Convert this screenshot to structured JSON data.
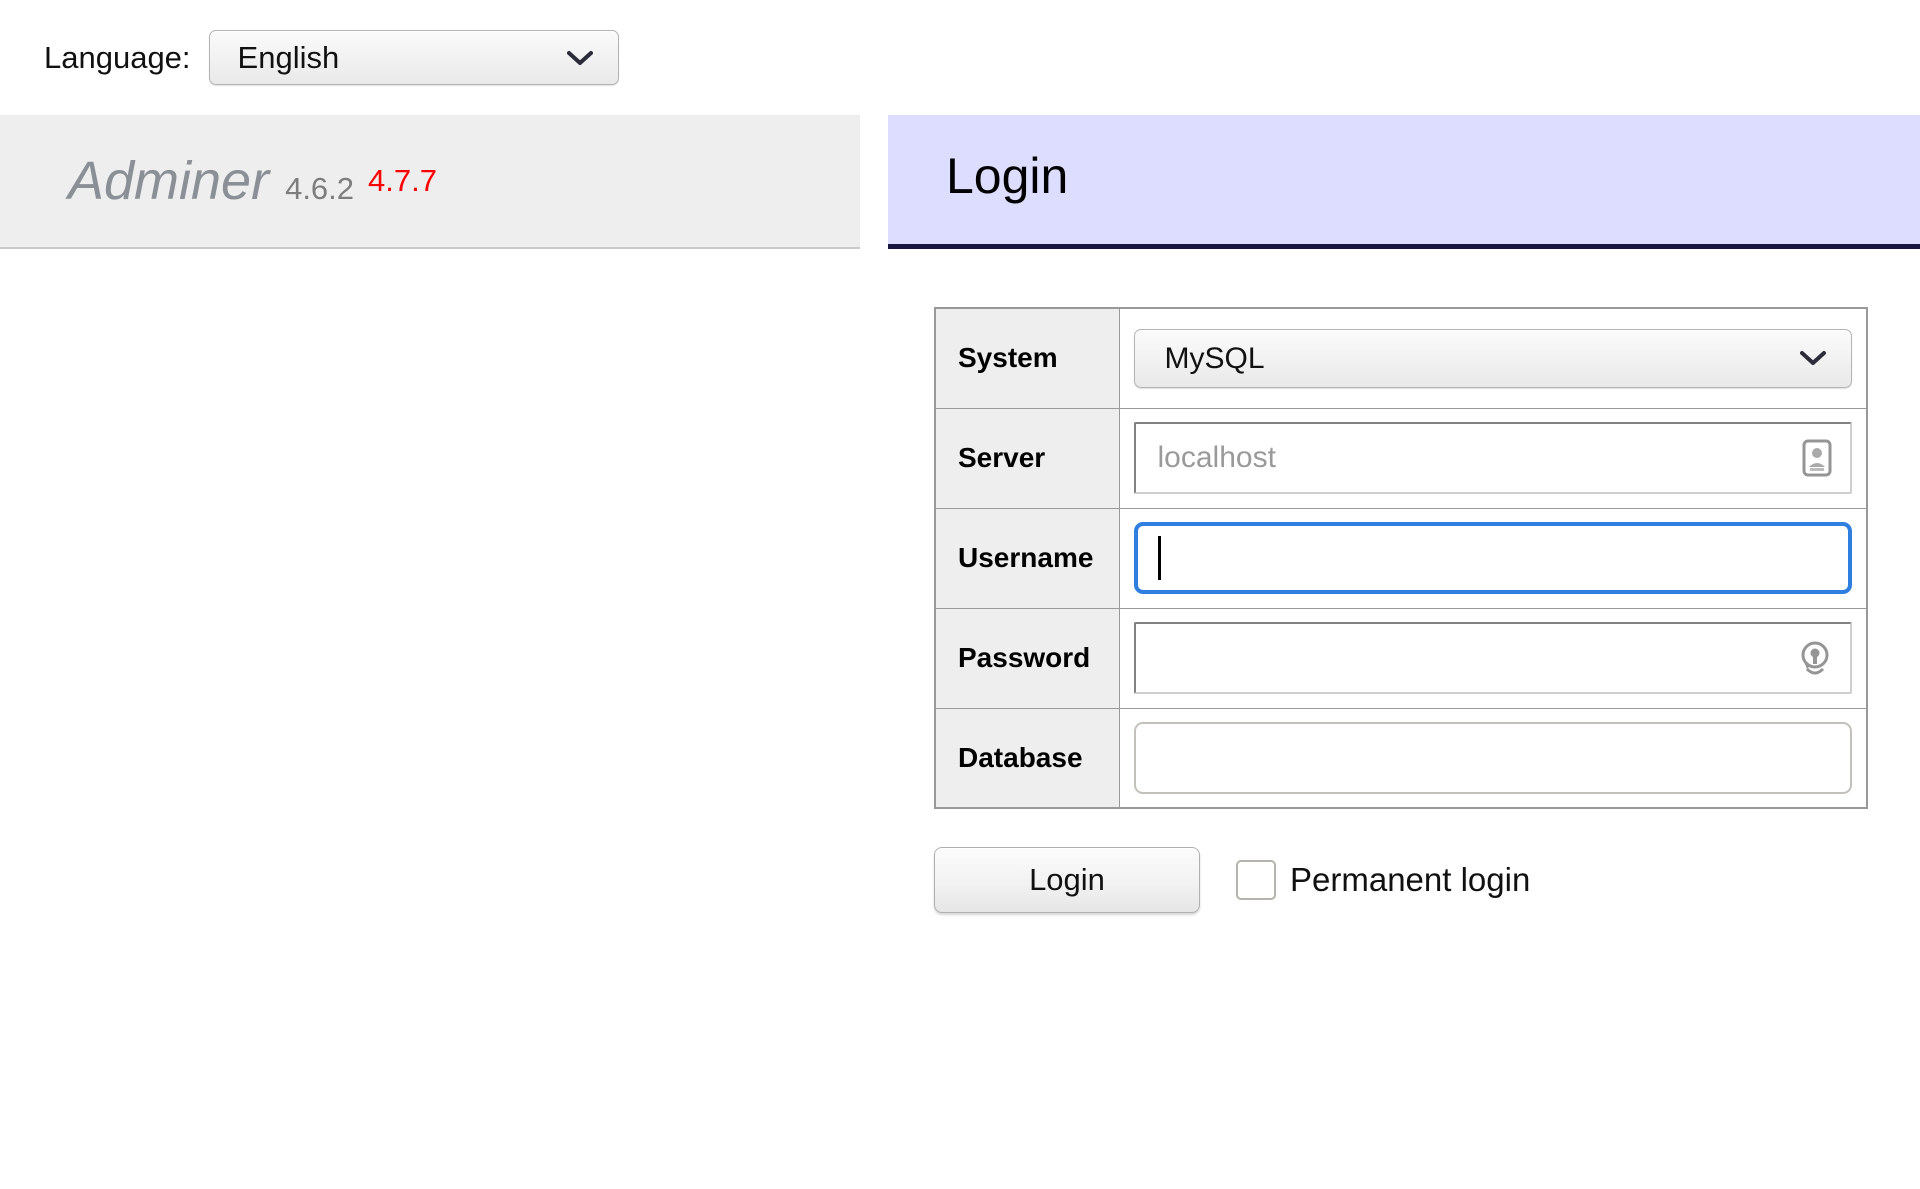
{
  "language_bar": {
    "label": "Language:",
    "selected": "English",
    "options": [
      "English"
    ],
    "chevron_icon": "chevron-down-icon"
  },
  "sidebar": {
    "logo_name": "Adminer",
    "version": "4.6.2",
    "update_version": "4.7.7",
    "update_color": "#ff0000"
  },
  "main": {
    "title": "Login",
    "title_background": "#ddddff",
    "title_underline": "#16163f"
  },
  "form": {
    "rows": [
      {
        "label": "System",
        "type": "select",
        "value": "MySQL",
        "options": [
          "MySQL"
        ],
        "icon": "chevron-down-icon"
      },
      {
        "label": "Server",
        "type": "text",
        "value": "",
        "placeholder": "localhost",
        "icon": "contact-card-autofill-icon"
      },
      {
        "label": "Username",
        "type": "text",
        "value": "",
        "placeholder": "",
        "focused": true,
        "icon": ""
      },
      {
        "label": "Password",
        "type": "password",
        "value": "",
        "placeholder": "",
        "icon": "password-key-icon"
      },
      {
        "label": "Database",
        "type": "text",
        "value": "",
        "placeholder": "",
        "icon": ""
      }
    ],
    "submit_label": "Login",
    "permanent_login_label": "Permanent login",
    "permanent_login_checked": false
  },
  "colors": {
    "focus_ring": "#2f7fe0",
    "header_bg": "#ddddff",
    "sidebar_bg": "#eeeeee",
    "table_border": "#999999"
  }
}
